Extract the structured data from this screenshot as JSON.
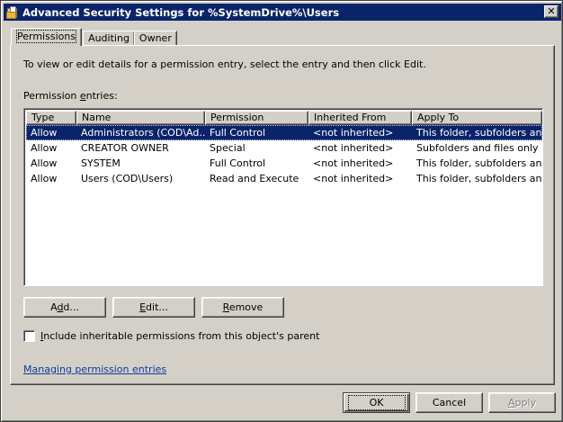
{
  "window": {
    "title": "Advanced Security Settings for %SystemDrive%\\Users",
    "close_glyph": "✕",
    "icon": "folder-icon"
  },
  "tabs": [
    {
      "label": "Permissions",
      "active": true
    },
    {
      "label": "Auditing",
      "active": false
    },
    {
      "label": "Owner",
      "active": false
    }
  ],
  "panel": {
    "instruction": "To view or edit details for a permission entry, select the entry and then click Edit.",
    "entries_label_pre": "Permission ",
    "entries_label_accel": "e",
    "entries_label_post": "ntries:"
  },
  "list": {
    "columns": [
      "Type",
      "Name",
      "Permission",
      "Inherited From",
      "Apply To"
    ],
    "rows": [
      [
        "Allow",
        "Administrators (COD\\Ad...",
        "Full Control",
        "<not inherited>",
        "This folder, subfolders and..."
      ],
      [
        "Allow",
        "CREATOR OWNER",
        "Special",
        "<not inherited>",
        "Subfolders and files only"
      ],
      [
        "Allow",
        "SYSTEM",
        "Full Control",
        "<not inherited>",
        "This folder, subfolders and..."
      ],
      [
        "Allow",
        "Users (COD\\Users)",
        "Read and Execute",
        "<not inherited>",
        "This folder, subfolders and..."
      ]
    ],
    "selected_index": 0
  },
  "buttons": {
    "add_pre": "A",
    "add_accel": "d",
    "add_post": "d...",
    "edit_pre": "",
    "edit_accel": "E",
    "edit_post": "dit...",
    "remove_pre": "",
    "remove_accel": "R",
    "remove_post": "emove"
  },
  "checkbox": {
    "label_pre": "",
    "label_accel": "I",
    "label_post": "nclude inheritable permissions from this object's parent",
    "checked": false
  },
  "link": {
    "text": "Managing permission entries"
  },
  "footer": {
    "ok": "OK",
    "cancel": "Cancel",
    "apply_accel": "A",
    "apply_post": "pply"
  },
  "colors": {
    "titlebar": "#0a246a",
    "selection": "#0a246a",
    "face": "#d4d0c8",
    "link": "#0a3ca0"
  }
}
